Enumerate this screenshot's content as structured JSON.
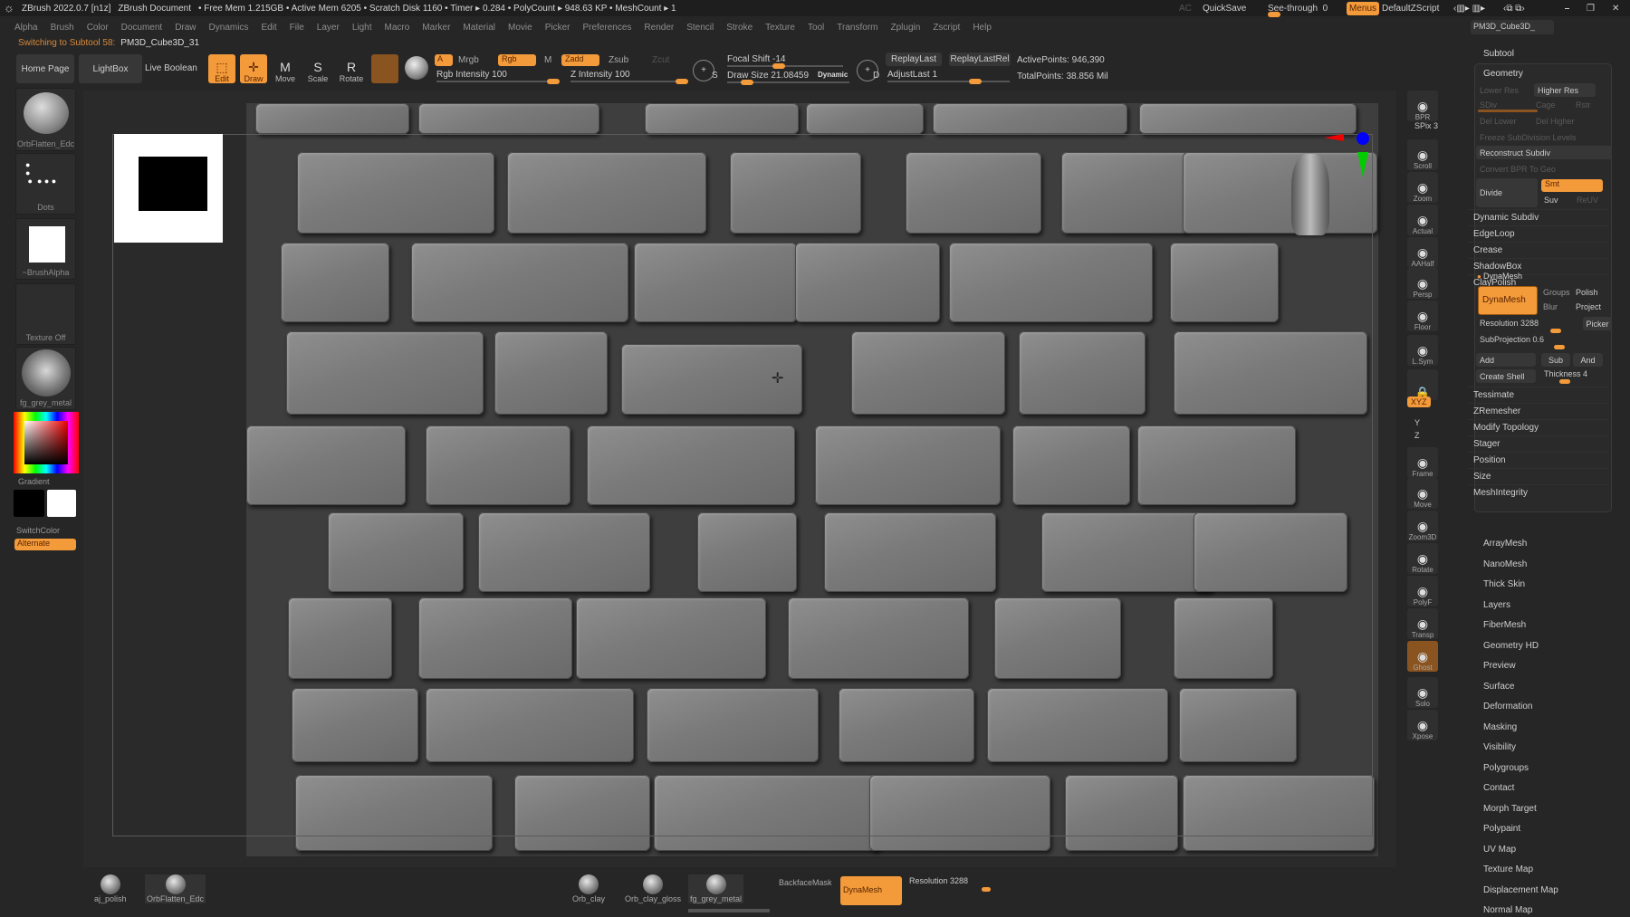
{
  "titlebar": {
    "app": "ZBrush 2022.0.7 [n1z]",
    "document": "ZBrush Document",
    "stats": "• Free Mem 1.215GB • Active Mem 6205 • Scratch Disk 1160 • Timer ▸ 0.284 • PolyCount ▸ 948.63 KP • MeshCount ▸ 1",
    "ac": "AC",
    "quicksave": "QuickSave",
    "see_through_label": "See-through",
    "see_through_value": "0",
    "menus": "Menus",
    "script": "DefaultZScript",
    "minimize": "⎯",
    "restore": "❐",
    "close": "✕"
  },
  "menu": [
    "Alpha",
    "Brush",
    "Color",
    "Document",
    "Draw",
    "Dynamics",
    "Edit",
    "File",
    "Layer",
    "Light",
    "Macro",
    "Marker",
    "Material",
    "Movie",
    "Picker",
    "Preferences",
    "Render",
    "Stencil",
    "Stroke",
    "Texture",
    "Tool",
    "Transform",
    "Zplugin",
    "Zscript",
    "Help"
  ],
  "status": {
    "prefix": "Switching to Subtool 58:",
    "name": "PM3D_Cube3D_31"
  },
  "toolbar": {
    "home": "Home Page",
    "lightbox": "LightBox",
    "live_boolean": "Live Boolean",
    "edit": "Edit",
    "draw": "Draw",
    "move": "Move",
    "scale": "Scale",
    "rotate": "Rotate",
    "a": "A",
    "mrgb": "Mrgb",
    "rgb": "Rgb",
    "m": "M",
    "rgb_intensity": "Rgb Intensity 100",
    "zadd": "Zadd",
    "zsub": "Zsub",
    "zcut": "Zcut",
    "z_intensity": "Z Intensity 100",
    "focal_shift": "Focal Shift -14",
    "draw_size": "Draw Size 21.08459",
    "dynamic": "Dynamic",
    "replay_last": "ReplayLast",
    "replay_last_rel": "ReplayLastRel",
    "adjust_last": "AdjustLast 1",
    "active_points": "ActivePoints: 946,390",
    "total_points": "TotalPoints: 38.856 Mil",
    "s": "S",
    "d": "D"
  },
  "left_shelf": {
    "brush": "OrbFlatten_Edc",
    "stroke": "Dots",
    "alpha": "~BrushAlpha",
    "texture": "Texture Off",
    "material": "fg_grey_metal",
    "gradient": "Gradient",
    "switch_color": "SwitchColor",
    "alternate": "Alternate"
  },
  "right_strip": [
    "BPR",
    "SPix 3",
    "Scroll",
    "Zoom",
    "Actual",
    "AAHalf",
    "Persp",
    "Floor",
    "L.Sym",
    "",
    "XYZ",
    "Y",
    "Z",
    "Frame",
    "Move",
    "Zoom3D",
    "Rotate",
    "PolyF",
    "Transp",
    "Ghost",
    "Solo",
    "Xpose"
  ],
  "tray": {
    "subtool_name": "PM3D_Cube3D_",
    "subtool": "Subtool",
    "geometry": "Geometry",
    "lower_res": "Lower Res",
    "higher_res": "Higher Res",
    "sdiv": "SDiv",
    "cage": "Cage",
    "rstr": "Rstr",
    "del_lower": "Del Lower",
    "del_higher": "Del Higher",
    "freeze": "Freeze SubDivision Levels",
    "reconstruct": "Reconstruct Subdiv",
    "convert_bpr": "Convert BPR To Geo",
    "divide": "Divide",
    "smt": "Smt",
    "suv": "Suv",
    "reuv": "ReUV",
    "geo_items": [
      "Dynamic Subdiv",
      "EdgeLoop",
      "Crease",
      "ShadowBox",
      "ClayPolish"
    ],
    "dynamesh_header": "DynaMesh",
    "dynamesh_btn": "DynaMesh",
    "groups": "Groups",
    "polish": "Polish",
    "blur": "Blur",
    "project": "Project",
    "resolution": "Resolution 3288",
    "picker": "Picker",
    "subprojection": "SubProjection 0.6",
    "add": "Add",
    "sub": "Sub",
    "and": "And",
    "create_shell": "Create Shell",
    "thickness": "Thickness 4",
    "geo_items2": [
      "Tessimate",
      "ZRemesher",
      "Modify Topology",
      "Stager",
      "Position",
      "Size",
      "MeshIntegrity"
    ],
    "sections": [
      "ArrayMesh",
      "NanoMesh",
      "Thick Skin",
      "Layers",
      "FiberMesh",
      "Geometry HD",
      "Preview",
      "Surface",
      "Deformation",
      "Masking",
      "Visibility",
      "Polygroups",
      "Contact",
      "Morph Target",
      "Polypaint",
      "UV Map",
      "Texture Map",
      "Displacement Map",
      "Normal Map"
    ]
  },
  "bottom": {
    "brushes": [
      "aj_polish",
      "OrbFlatten_Edc"
    ],
    "materials": [
      "Orb_clay",
      "Orb_clay_gloss",
      "fg_grey_metal"
    ],
    "backface": "BackfaceMask",
    "dynamesh": "DynaMesh",
    "resolution": "Resolution 3288"
  },
  "colors": {
    "accent": "#f39a3a",
    "panel": "#262626"
  }
}
